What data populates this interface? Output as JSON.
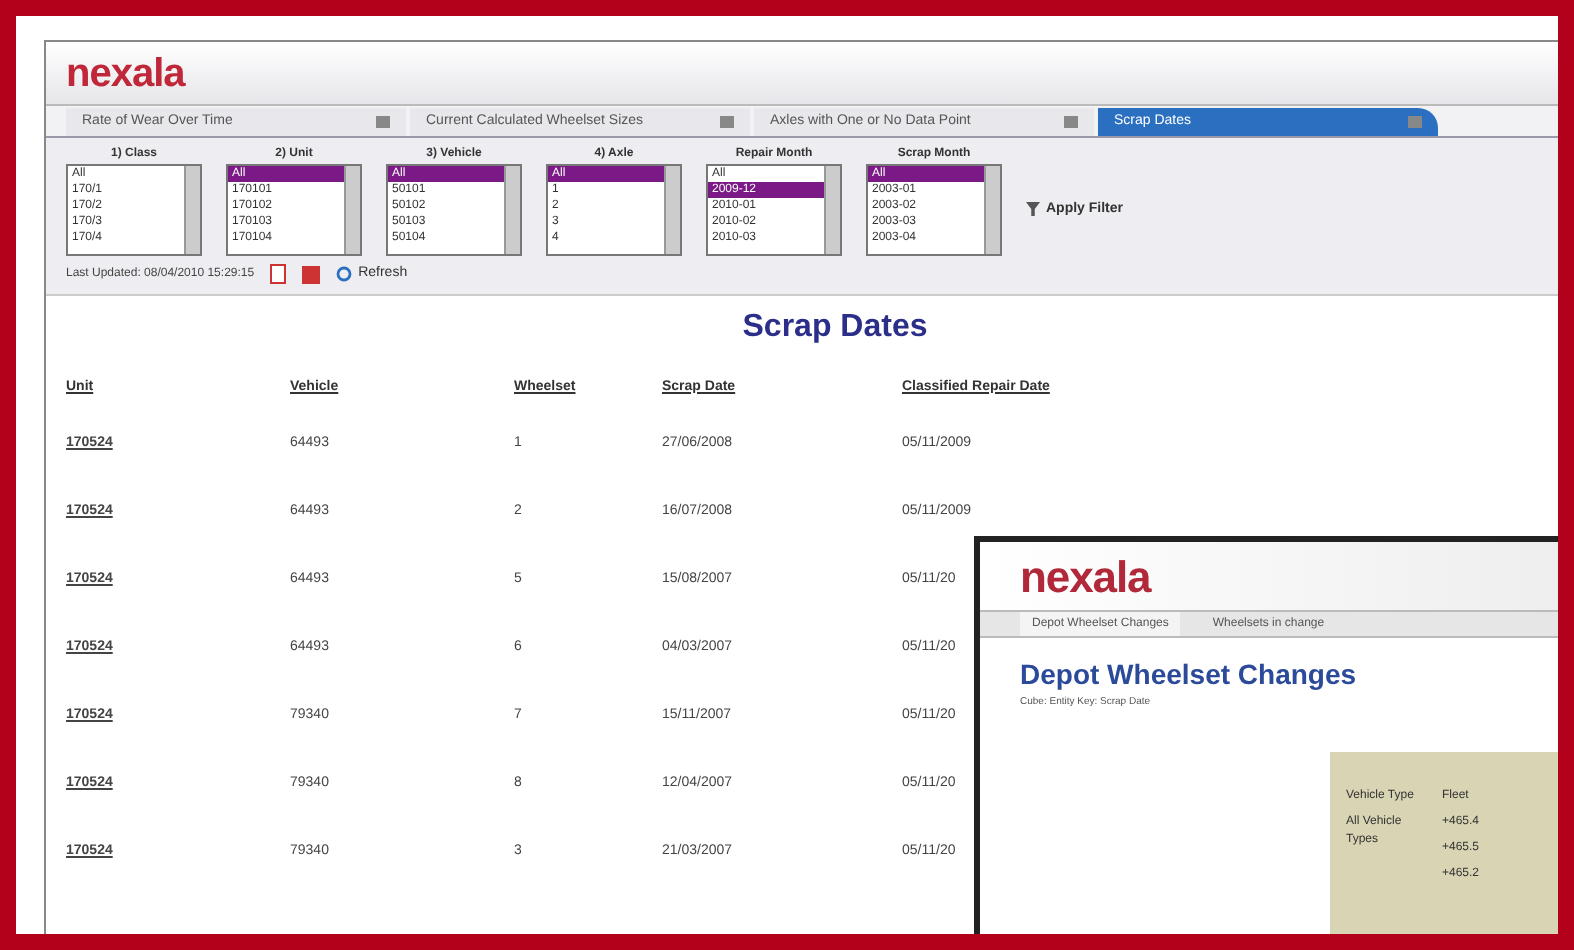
{
  "main": {
    "logo": "nexala",
    "tabs": [
      {
        "label": "Rate of Wear Over Time",
        "selected": false
      },
      {
        "label": "Current Calculated Wheelset Sizes",
        "selected": false
      },
      {
        "label": "Axles with One or No Data Point",
        "selected": false
      },
      {
        "label": "Scrap Dates",
        "selected": true
      }
    ],
    "filters": [
      {
        "label": "1) Class",
        "options": [
          {
            "text": "All",
            "selected": false
          },
          {
            "text": "170/1",
            "selected": false
          },
          {
            "text": "170/2",
            "selected": false
          },
          {
            "text": "170/3",
            "selected": false
          },
          {
            "text": "170/4",
            "selected": false
          }
        ]
      },
      {
        "label": "2) Unit",
        "options": [
          {
            "text": "All",
            "selected": true
          },
          {
            "text": "170101",
            "selected": false
          },
          {
            "text": "170102",
            "selected": false
          },
          {
            "text": "170103",
            "selected": false
          },
          {
            "text": "170104",
            "selected": false
          }
        ]
      },
      {
        "label": "3) Vehicle",
        "options": [
          {
            "text": "All",
            "selected": true
          },
          {
            "text": "50101",
            "selected": false
          },
          {
            "text": "50102",
            "selected": false
          },
          {
            "text": "50103",
            "selected": false
          },
          {
            "text": "50104",
            "selected": false
          }
        ]
      },
      {
        "label": "4) Axle",
        "options": [
          {
            "text": "All",
            "selected": true
          },
          {
            "text": "1",
            "selected": false
          },
          {
            "text": "2",
            "selected": false
          },
          {
            "text": "3",
            "selected": false
          },
          {
            "text": "4",
            "selected": false
          }
        ]
      },
      {
        "label": "Repair Month",
        "options": [
          {
            "text": "All",
            "selected": false
          },
          {
            "text": "2009-12",
            "selected": true
          },
          {
            "text": "2010-01",
            "selected": false
          },
          {
            "text": "2010-02",
            "selected": false
          },
          {
            "text": "2010-03",
            "selected": false
          }
        ]
      },
      {
        "label": "Scrap Month",
        "options": [
          {
            "text": "All",
            "selected": true
          },
          {
            "text": "2003-01",
            "selected": false
          },
          {
            "text": "2003-02",
            "selected": false
          },
          {
            "text": "2003-03",
            "selected": false
          },
          {
            "text": "2003-04",
            "selected": false
          }
        ]
      }
    ],
    "apply_button": "Apply Filter",
    "last_updated": "Last Updated: 08/04/2010 15:29:15",
    "refresh_button": "Refresh",
    "title": "Scrap Dates",
    "table": {
      "columns": [
        "Unit",
        "Vehicle",
        "Wheelset",
        "Scrap Date",
        "Classified Repair Date"
      ],
      "rows": [
        [
          "170524",
          "64493",
          "1",
          "27/06/2008",
          "05/11/2009"
        ],
        [
          "170524",
          "64493",
          "2",
          "16/07/2008",
          "05/11/2009"
        ],
        [
          "170524",
          "64493",
          "5",
          "15/08/2007",
          "05/11/20"
        ],
        [
          "170524",
          "64493",
          "6",
          "04/03/2007",
          "05/11/20"
        ],
        [
          "170524",
          "79340",
          "7",
          "15/11/2007",
          "05/11/20"
        ],
        [
          "170524",
          "79340",
          "8",
          "12/04/2007",
          "05/11/20"
        ],
        [
          "170524",
          "79340",
          "3",
          "21/03/2007",
          "05/11/20"
        ]
      ]
    }
  },
  "inset": {
    "logo": "nexala",
    "tabs": [
      {
        "label": "Depot Wheelset Changes",
        "selected": true
      },
      {
        "label": "Wheelsets in change",
        "selected": false
      }
    ],
    "title": "Depot Wheelset Changes",
    "subtitle": "Cube: Entity Key: Scrap Date",
    "pivot": {
      "headers": [
        "Vehicle Type",
        "Fleet"
      ],
      "row_label": "All Vehicle Types",
      "values": [
        "+465.4",
        "+465.5",
        "+465.2"
      ]
    }
  }
}
